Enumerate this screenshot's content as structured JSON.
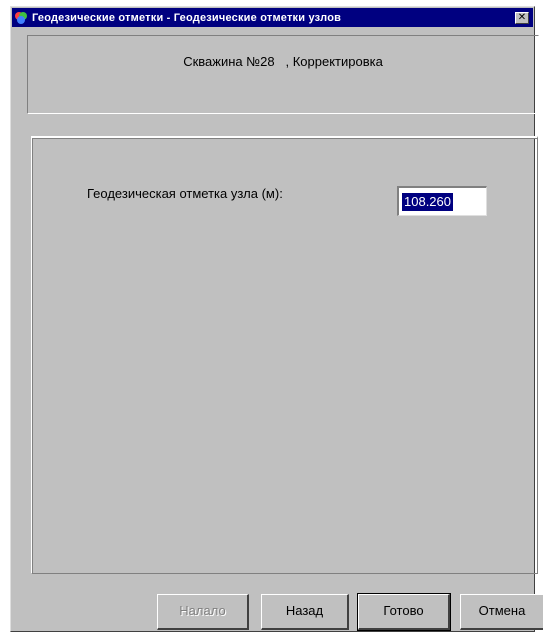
{
  "window": {
    "title": "Геодезические отметки - Геодезические отметки узлов",
    "close_glyph": "✕"
  },
  "header": {
    "text": "Скважина №28   , Корректировка"
  },
  "form": {
    "label": "Геодезическая отметка узла (м):",
    "value": "108.260"
  },
  "buttons": {
    "next": "Налало",
    "back": "Назад",
    "finish": "Готово",
    "cancel": "Отмена"
  },
  "colors": {
    "titlebar": "#000080",
    "face": "#c0c0c0",
    "selection": "#000080"
  },
  "icons": {
    "app": "app-icon",
    "close": "close-icon"
  }
}
